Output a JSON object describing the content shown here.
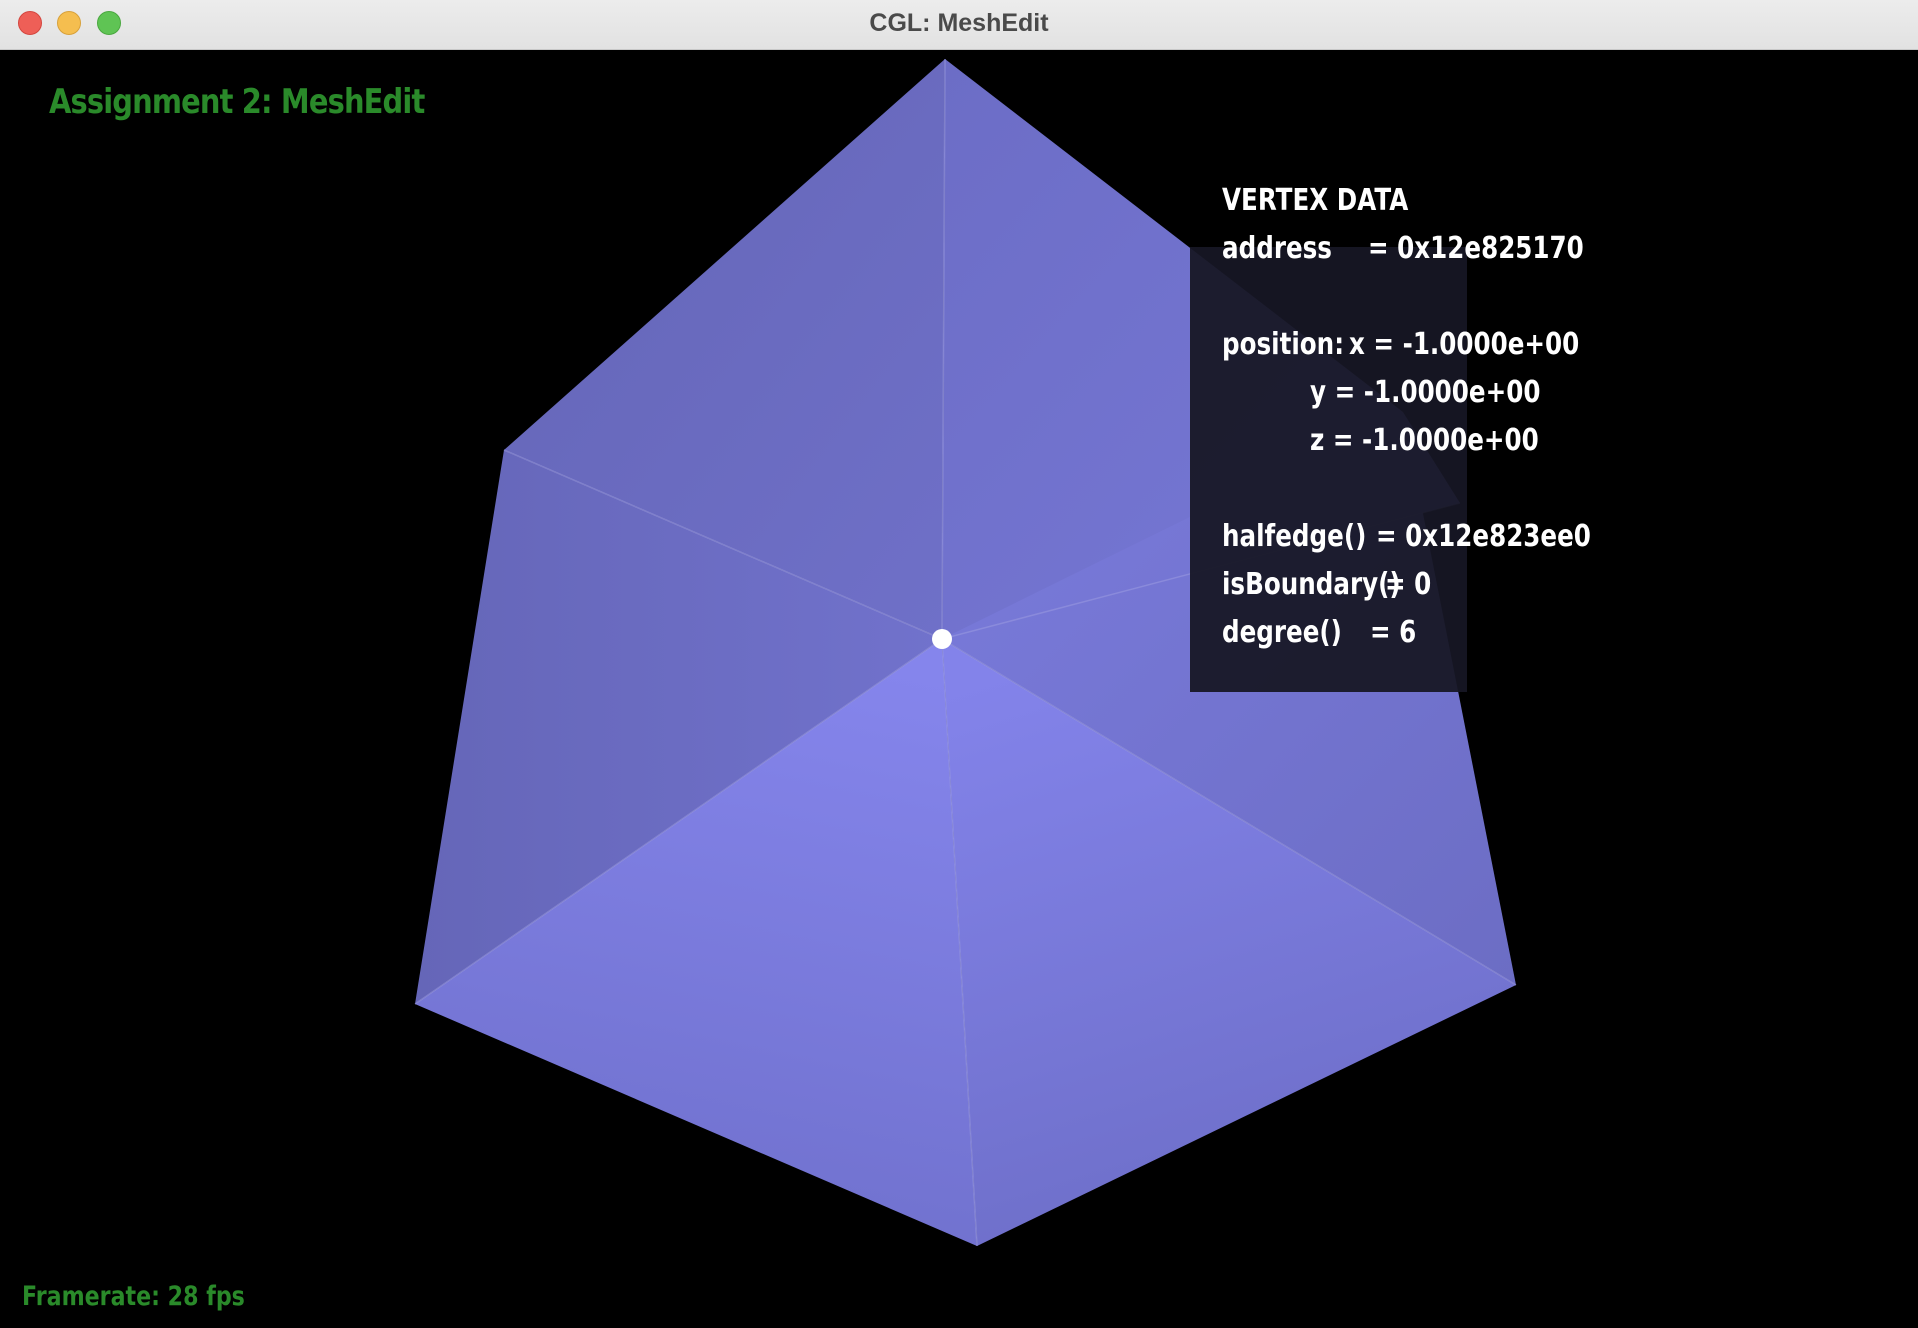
{
  "window": {
    "title": "CGL: MeshEdit"
  },
  "app": {
    "title": "Assignment 2: MeshEdit",
    "framerate": "Framerate: 28 fps"
  },
  "vertex_info": {
    "heading": "VERTEX DATA",
    "address_label": "address",
    "address_value": "= 0x12e825170",
    "position_label": "position:",
    "x": "x = -1.0000e+00",
    "y": "y = -1.0000e+00",
    "z": "z = -1.0000e+00",
    "halfedge_label": "halfedge()",
    "halfedge_value": "= 0x12e823ee0",
    "boundary_label": "isBoundary()",
    "boundary_value": "= 0",
    "degree_label": "degree()",
    "degree_value": "= 6"
  },
  "colors": {
    "app_text": "#2a8a2a",
    "mesh_face": "#6b6cc4",
    "mesh_face_light": "#8585ec",
    "selected_vertex": "#ffffff",
    "panel_bg": "#161624"
  }
}
